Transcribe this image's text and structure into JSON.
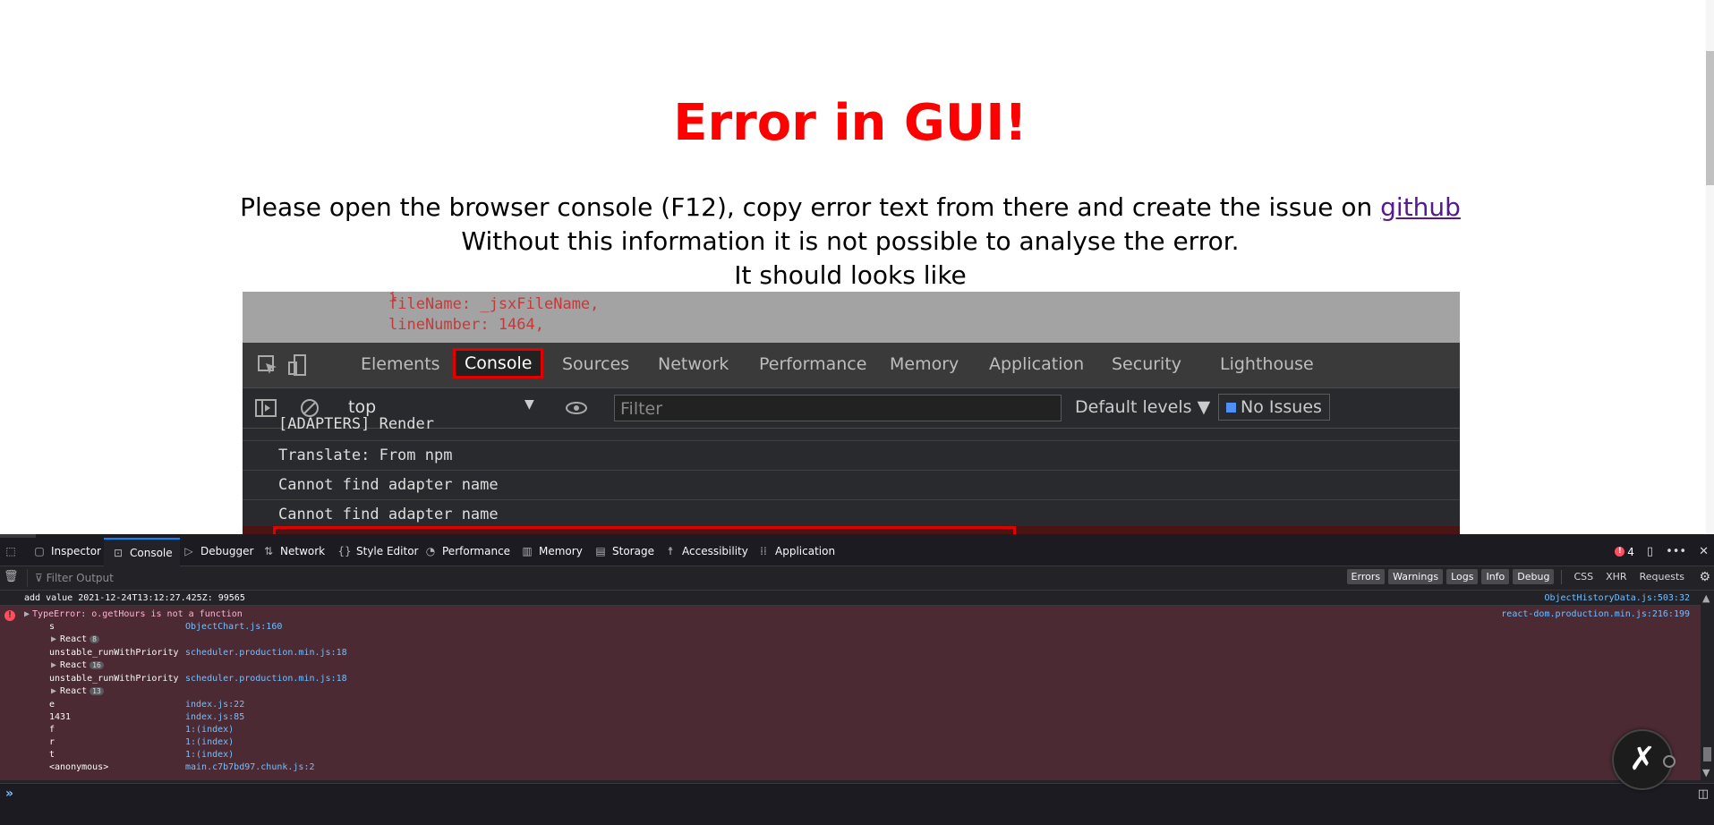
{
  "page": {
    "title": "Error in GUI!",
    "message_prefix": "Please open the browser console (F12), copy error text from there and create the issue on ",
    "message_link": "github",
    "line2": "Without this information it is not possible to analyse the error.",
    "line3": "It should looks like"
  },
  "sample": {
    "code_lines": [
      "fileName: _jsxFileName,",
      "lineNumber: 1464,"
    ],
    "tabs": [
      "Elements",
      "Console",
      "Sources",
      "Network",
      "Performance",
      "Memory",
      "Application",
      "Security",
      "Lighthouse"
    ],
    "active_tab": "Console",
    "context": "top",
    "filter_placeholder": "Filter",
    "levels": "Default levels ▼",
    "issues": "No Issues",
    "log_lines": [
      "[ADAPTERS] Render",
      "Translate: From npm",
      "Cannot find adapter name",
      "Cannot find adapter name"
    ]
  },
  "devtools": {
    "tabs": [
      {
        "label": "Inspector",
        "icon": "inspector-icon"
      },
      {
        "label": "Console",
        "icon": "console-icon"
      },
      {
        "label": "Debugger",
        "icon": "debugger-icon"
      },
      {
        "label": "Network",
        "icon": "network-icon"
      },
      {
        "label": "Style Editor",
        "icon": "style-editor-icon"
      },
      {
        "label": "Performance",
        "icon": "performance-icon"
      },
      {
        "label": "Memory",
        "icon": "memory-icon"
      },
      {
        "label": "Storage",
        "icon": "storage-icon"
      },
      {
        "label": "Accessibility",
        "icon": "accessibility-icon"
      },
      {
        "label": "Application",
        "icon": "application-icon"
      }
    ],
    "selected_tab": "Console",
    "error_count": "4",
    "filter_placeholder": "Filter Output",
    "levels": [
      "Errors",
      "Warnings",
      "Logs",
      "Info",
      "Debug"
    ],
    "requests": [
      "CSS",
      "XHR",
      "Requests"
    ],
    "log": {
      "text": "add value 2021-12-24T13:12:27.425Z: 99565",
      "source": "ObjectHistoryData.js:503:32"
    },
    "error": {
      "message": "TypeError: o.getHours is not a function",
      "source": "react-dom.production.min.js:216:199",
      "frames": [
        {
          "fn": "s",
          "loc": "ObjectChart.js:160"
        },
        {
          "group": "React",
          "count": "8"
        },
        {
          "fn": "unstable_runWithPriority",
          "loc": "scheduler.production.min.js:18"
        },
        {
          "group": "React",
          "count": "16"
        },
        {
          "fn": "unstable_runWithPriority",
          "loc": "scheduler.production.min.js:18"
        },
        {
          "group": "React",
          "count": "13"
        },
        {
          "fn": "e",
          "loc": "index.js:22"
        },
        {
          "fn": "1431",
          "loc": "index.js:85"
        },
        {
          "fn": "f",
          "loc": "1:(index)"
        },
        {
          "fn": "r",
          "loc": "1:(index)"
        },
        {
          "fn": "t",
          "loc": "1:(index)"
        },
        {
          "fn": "<anonymous>",
          "loc": "main.c7b7bd97.chunk.js:2"
        }
      ]
    }
  }
}
